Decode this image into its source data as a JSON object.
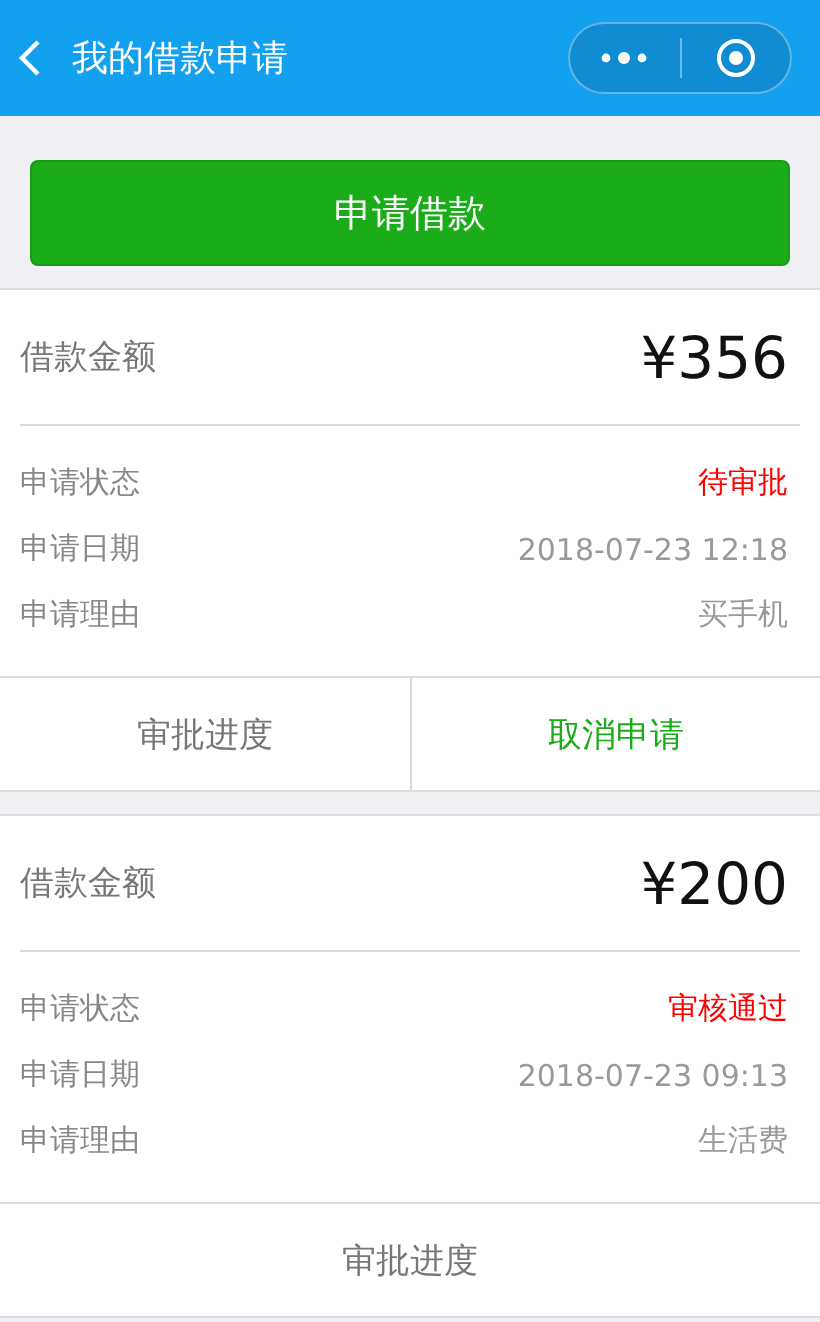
{
  "header": {
    "title": "我的借款申请"
  },
  "apply_button": "申请借款",
  "loans": [
    {
      "amount_label": "借款金额",
      "amount": "¥356",
      "fields": [
        {
          "label": "申请状态",
          "value": "待审批",
          "kind": "status"
        },
        {
          "label": "申请日期",
          "value": "2018-07-23 12:18",
          "kind": "plain"
        },
        {
          "label": "申请理由",
          "value": "买手机",
          "kind": "plain"
        }
      ],
      "actions": [
        {
          "label": "审批进度",
          "kind": "default"
        },
        {
          "label": "取消申请",
          "kind": "primary"
        }
      ]
    },
    {
      "amount_label": "借款金额",
      "amount": "¥200",
      "fields": [
        {
          "label": "申请状态",
          "value": "审核通过",
          "kind": "status"
        },
        {
          "label": "申请日期",
          "value": "2018-07-23 09:13",
          "kind": "plain"
        },
        {
          "label": "申请理由",
          "value": "生活费",
          "kind": "plain"
        }
      ],
      "actions": [
        {
          "label": "审批进度",
          "kind": "default"
        }
      ]
    }
  ]
}
